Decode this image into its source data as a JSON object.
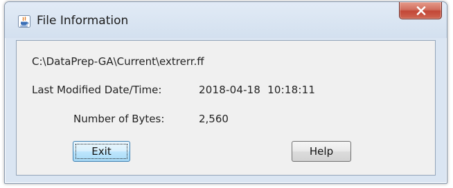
{
  "window": {
    "title": "File Information",
    "title_icon": "java-cup-icon",
    "close_icon": "close-x-icon"
  },
  "info": {
    "file_path": "C:\\DataPrep-GA\\Current\\extrerr.ff",
    "modified_label": "Last Modified Date/Time:",
    "modified_value": "2018-04-18  10:18:11",
    "bytes_label": "Number of Bytes:",
    "bytes_value": "2,560"
  },
  "buttons": {
    "exit_label": "Exit",
    "help_label": "Help"
  },
  "colors": {
    "close_button": "#c24737",
    "content_background": "#f0f0f0",
    "frame": "#dae5f2"
  }
}
